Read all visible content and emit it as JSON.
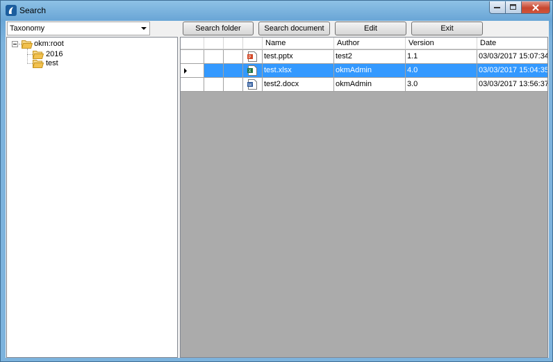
{
  "window": {
    "title": "Search",
    "controls": [
      "minimize",
      "maximize",
      "close"
    ]
  },
  "toolbar": {
    "taxonomy_value": "Taxonomy",
    "search_folder_label": "Search folder",
    "search_document_label": "Search document",
    "edit_label": "Edit",
    "exit_label": "Exit"
  },
  "tree": {
    "root": {
      "label": "okm:root",
      "icon": "folder-open-icon"
    },
    "children": [
      {
        "label": "2016",
        "icon": "folder-icon"
      },
      {
        "label": "test",
        "icon": "folder-icon"
      }
    ]
  },
  "grid": {
    "columns": [
      "Name",
      "Author",
      "Version",
      "Date"
    ],
    "rows": [
      {
        "name": "test.pptx",
        "author": "test2",
        "version": "1.1",
        "date": "03/03/2017 15:07:34",
        "icon": "powerpoint-file-icon",
        "selected": false
      },
      {
        "name": "test.xlsx",
        "author": "okmAdmin",
        "version": "4.0",
        "date": "03/03/2017 15:04:35",
        "icon": "excel-file-icon",
        "selected": true
      },
      {
        "name": "test2.docx",
        "author": "okmAdmin",
        "version": "3.0",
        "date": "03/03/2017 13:56:37",
        "icon": "word-file-icon",
        "selected": false
      }
    ]
  },
  "colors": {
    "selection": "#3399ff",
    "grid_background": "#ababab",
    "title_bar": "#7db3dd",
    "close_button": "#c7472f",
    "folder": "#f2c14e"
  }
}
